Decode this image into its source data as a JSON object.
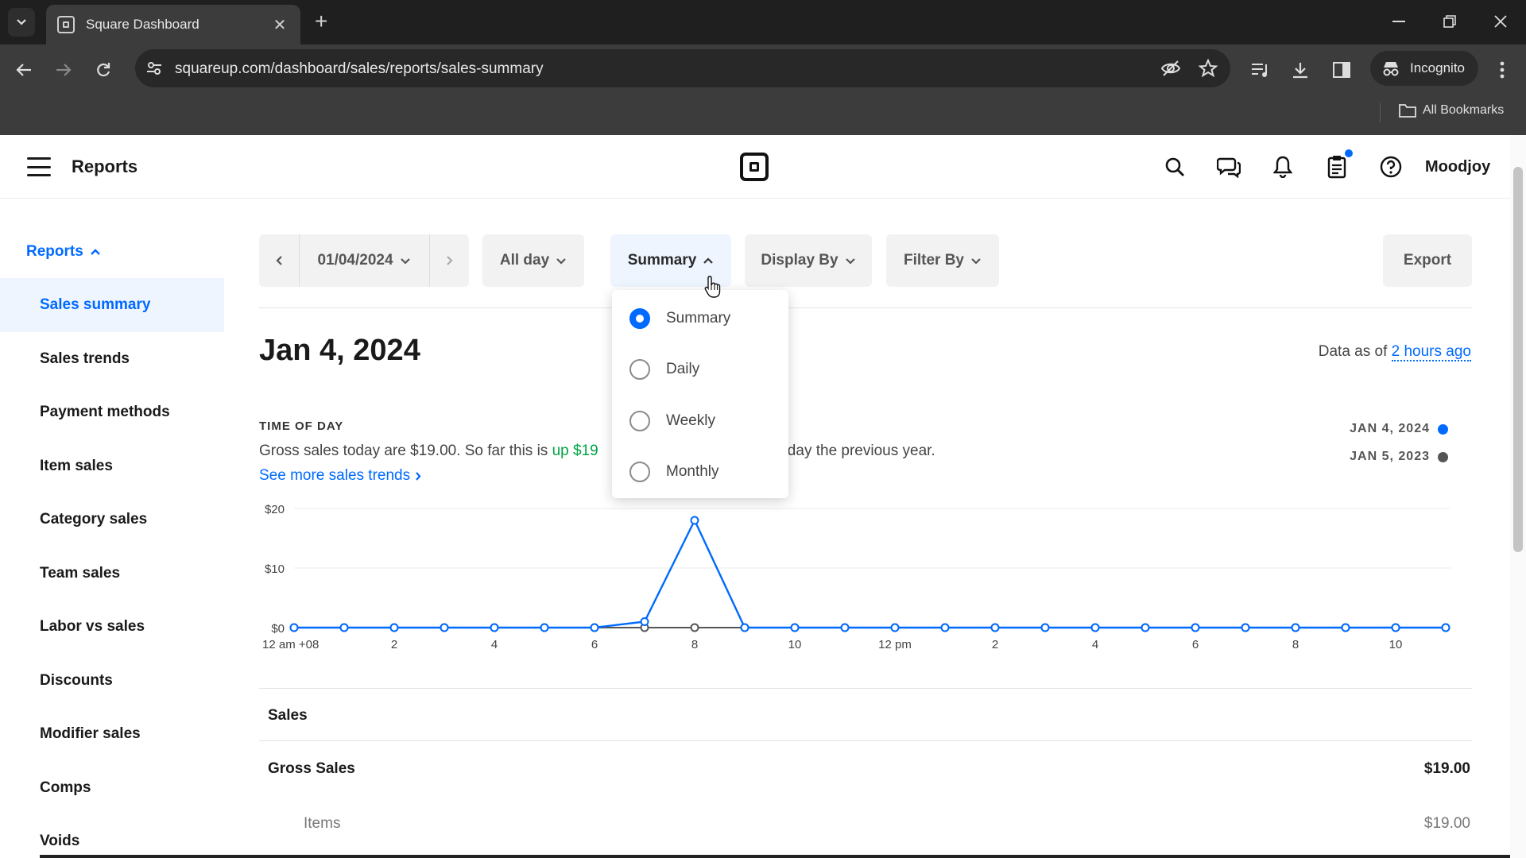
{
  "browser": {
    "tab_title": "Square Dashboard",
    "url": "squareup.com/dashboard/sales/reports/sales-summary",
    "incognito_label": "Incognito",
    "bookmarks_label": "All Bookmarks"
  },
  "header": {
    "title": "Reports",
    "user": "Moodjoy",
    "accent": "#006aff"
  },
  "sidebar": {
    "section": "Reports",
    "items": [
      {
        "label": "Sales summary",
        "active": true
      },
      {
        "label": "Sales trends"
      },
      {
        "label": "Payment methods"
      },
      {
        "label": "Item sales"
      },
      {
        "label": "Category sales"
      },
      {
        "label": "Team sales"
      },
      {
        "label": "Labor vs sales"
      },
      {
        "label": "Discounts"
      },
      {
        "label": "Modifier sales"
      },
      {
        "label": "Comps"
      },
      {
        "label": "Voids"
      }
    ]
  },
  "filters": {
    "date": "01/04/2024",
    "time": "All day",
    "view": "Summary",
    "display_by": "Display By",
    "filter_by": "Filter By",
    "export": "Export"
  },
  "view_dropdown": {
    "options": [
      "Summary",
      "Daily",
      "Weekly",
      "Monthly"
    ],
    "selected": "Summary"
  },
  "main": {
    "date_title": "Jan 4, 2024",
    "data_as_of_prefix": "Data as of",
    "data_as_of_link": "2 hours ago",
    "section_label": "TIME OF DAY",
    "gross_text_1": "Gross sales today are $19.00. So far this is",
    "gross_text_up": "up $19",
    "gross_text_2": "rsday the previous year.",
    "see_more": "See more sales trends",
    "legend": [
      {
        "label": "JAN 4, 2024",
        "color": "#006aff"
      },
      {
        "label": "JAN 5, 2023",
        "color": "#555555"
      }
    ]
  },
  "chart_data": {
    "type": "line",
    "x_tick_labels": [
      "12 am +08",
      "2",
      "4",
      "6",
      "8",
      "10",
      "12 pm",
      "2",
      "4",
      "6",
      "8",
      "10"
    ],
    "y_tick_labels": [
      "$20",
      "$10",
      "$0"
    ],
    "ylim": [
      0,
      20
    ],
    "x_hours": [
      0,
      1,
      2,
      3,
      4,
      5,
      6,
      7,
      8,
      9,
      10,
      11,
      12,
      13,
      14,
      15,
      16,
      17,
      18,
      19,
      20,
      21,
      22,
      23
    ],
    "series": [
      {
        "name": "JAN 4, 2024",
        "color": "#006aff",
        "values": [
          0,
          0,
          0,
          0,
          0,
          0,
          0,
          1,
          18,
          0,
          0,
          0,
          0,
          0,
          0,
          0,
          0,
          0,
          0,
          0,
          0,
          0,
          0,
          0
        ]
      },
      {
        "name": "JAN 5, 2023",
        "color": "#555555",
        "values": [
          0,
          0,
          0,
          0,
          0,
          0,
          0,
          0,
          0,
          0,
          0,
          0,
          0,
          0,
          0,
          0,
          0,
          0,
          0,
          0,
          0,
          0,
          0,
          0
        ]
      }
    ],
    "grid": true
  },
  "sales": {
    "heading": "Sales",
    "rows": [
      {
        "label": "Gross Sales",
        "value": "$19.00"
      },
      {
        "label": "Items",
        "value": "$19.00"
      }
    ]
  }
}
